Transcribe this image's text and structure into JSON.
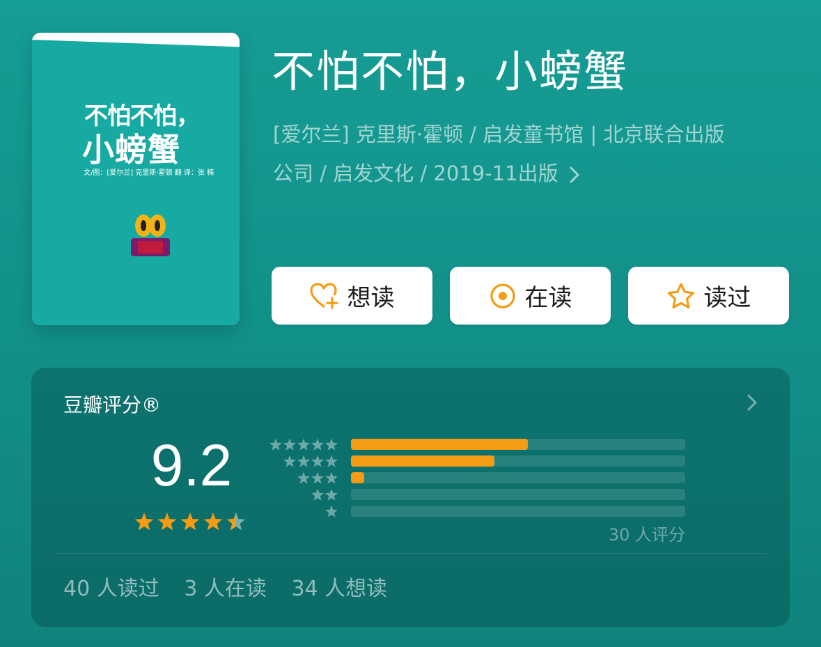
{
  "book": {
    "title": "不怕不怕，小螃蟹",
    "meta_line1": "[爱尔兰] 克里斯·霍顿 / 启发童书馆 | 北京联合出版",
    "meta_line2": "公司 / 启发文化 / 2019-11出版",
    "cover": {
      "title_line1": "不怕不怕，",
      "title_line2": "小螃蟹",
      "credit": "文/图：[爱尔兰] 克里斯·霍顿   翻 译：张 楠"
    }
  },
  "actions": {
    "want_label": "想读",
    "reading_label": "在读",
    "read_label": "读过"
  },
  "rating": {
    "label": "豆瓣评分®",
    "score": "9.2",
    "score_stars": 4.5,
    "distribution": [
      {
        "stars": 5,
        "fraction": 0.53
      },
      {
        "stars": 4,
        "fraction": 0.43
      },
      {
        "stars": 3,
        "fraction": 0.04
      },
      {
        "stars": 2,
        "fraction": 0.0
      },
      {
        "stars": 1,
        "fraction": 0.0
      }
    ],
    "count_text": "30 人评分"
  },
  "stats": {
    "read_text": "40 人读过",
    "reading_text": "3 人在读",
    "want_text": "34 人想读"
  },
  "colors": {
    "background": "#169d95",
    "accent": "#f69c14",
    "card": "#0b6e69"
  },
  "icons": {
    "want": "heart-plus-icon",
    "reading": "target-circle-icon",
    "read": "star-outline-icon",
    "more": "chevron-right-icon"
  }
}
